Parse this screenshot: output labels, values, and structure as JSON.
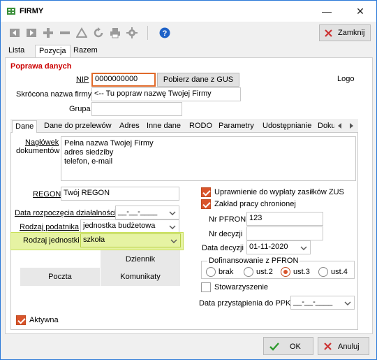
{
  "window": {
    "title": "FIRMY",
    "minimize": "—",
    "close": "✕"
  },
  "toolbar": {
    "icons": [
      "prev-icon",
      "next-icon",
      "add-icon",
      "remove-icon",
      "filter-icon",
      "refresh-icon",
      "print-icon",
      "settings-icon",
      "help-icon"
    ],
    "close_label": "Zamknij"
  },
  "main_tabs": [
    "Lista",
    "Pozycja",
    "Razem"
  ],
  "section_title": "Poprawa danych",
  "form": {
    "nip_label": "NIP",
    "nip_value": "0000000000",
    "gus_button": "Pobierz dane z GUS",
    "logo_label": "Logo",
    "short_name_label": "Skrócona nazwa firmy",
    "short_name_value": "<-- Tu popraw nazwę Twojej Firmy",
    "group_label": "Grupa",
    "group_value": ""
  },
  "sub_tabs": [
    "Dane",
    "Dane do przelewów",
    "Adres",
    "Inne dane",
    "RODO",
    "Parametry",
    "Udostępnianie",
    "Doku"
  ],
  "dane": {
    "headers_label_1": "Nagłówek",
    "headers_label_2": "dokumentów",
    "headers_lines": [
      "Pełna nazwa Twojej Firmy",
      "adres siedziby",
      "telefon, e-mail"
    ],
    "regon_label": "REGON",
    "regon_value": "Twój REGON",
    "start_date_label": "Data rozpoczęcia działalności",
    "start_date_value": "__-__-____",
    "taxpayer_label": "Rodzaj podatnika",
    "taxpayer_value": "jednostka budżetowa",
    "unit_type_label": "Rodzaj jednostki",
    "unit_type_value": "szkoła",
    "dziennik_button": "Dziennik",
    "poczta_button": "Poczta",
    "komunikaty_button": "Komunikaty",
    "zus_label": "Uprawnienie do wypłaty zasiłków ZUS",
    "zus_checked": true,
    "chroniony_label": "Zakład pracy chronionej",
    "chroniony_checked": true,
    "pfron_no_label": "Nr PFRON",
    "pfron_no_value": "123",
    "decision_no_label": "Nr decyzji",
    "decision_no_value": "",
    "decision_date_label": "Data decyzji",
    "decision_date_value": "01-11-2020",
    "pfron_group_label": "Dofinansowanie z PFRON",
    "pfron_options": [
      "brak",
      "ust.2",
      "ust.3",
      "ust.4"
    ],
    "pfron_selected": "ust.3",
    "association_label": "Stowarzyszenie",
    "association_checked": false,
    "ppk_label": "Data przystąpienia do PPK",
    "ppk_value": "__-__-____",
    "active_label": "Aktywna",
    "active_checked": true
  },
  "footer": {
    "ok_label": "OK",
    "cancel_label": "Anuluj"
  },
  "colors": {
    "accent": "#d9542b",
    "section_title": "#cc0000",
    "highlight": "#e6f3a3",
    "window_border": "#2b79d8"
  }
}
